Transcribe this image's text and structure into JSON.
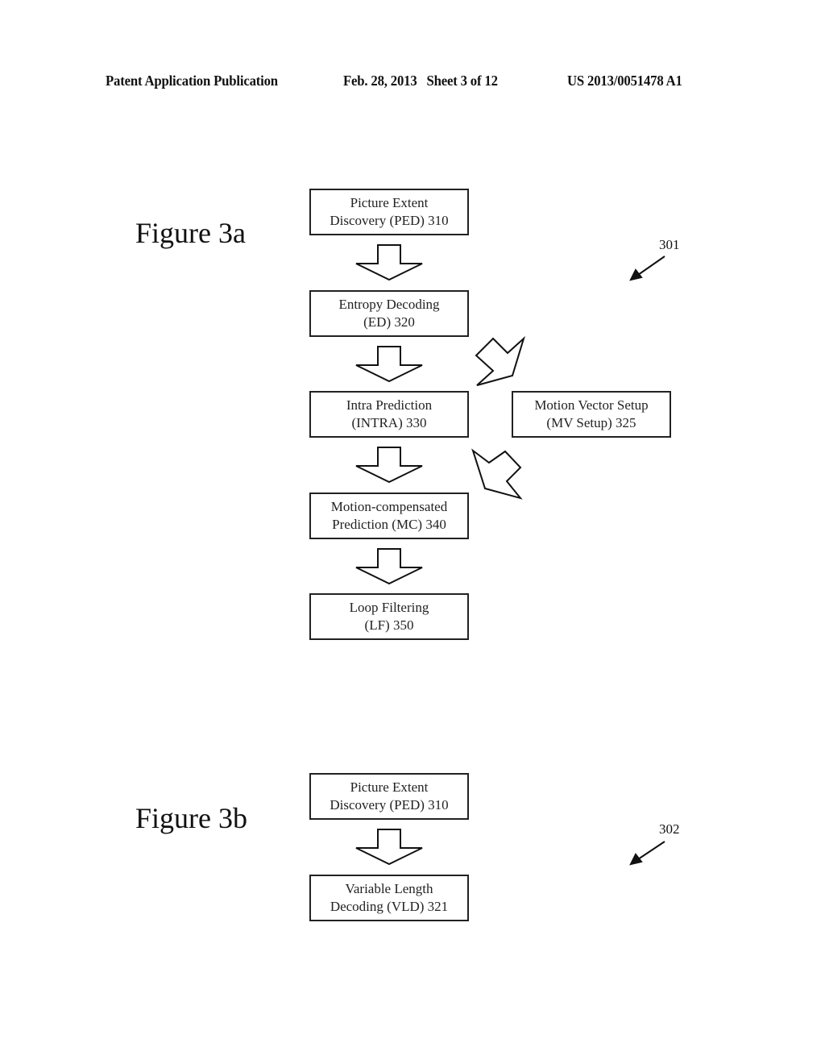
{
  "header": {
    "publication": "Patent Application Publication",
    "date_sheet": "Feb. 28, 2013   Sheet 3 of 12",
    "patent_number": "US 2013/0051478 A1"
  },
  "figure_3a": {
    "title": "Figure 3a",
    "reference": "301",
    "boxes": [
      {
        "line1": "Picture Extent",
        "line2": "Discovery (PED) 310"
      },
      {
        "line1": "Entropy Decoding",
        "line2": "(ED) 320"
      },
      {
        "line1": "Intra Prediction",
        "line2": "(INTRA) 330"
      },
      {
        "line1": "Motion-compensated",
        "line2": "Prediction (MC) 340"
      },
      {
        "line1": "Loop Filtering",
        "line2": "(LF) 350"
      }
    ],
    "side_box": {
      "line1": "Motion Vector Setup",
      "line2": "(MV Setup) 325"
    }
  },
  "figure_3b": {
    "title": "Figure 3b",
    "reference": "302",
    "boxes": [
      {
        "line1": "Picture Extent",
        "line2": "Discovery (PED) 310"
      },
      {
        "line1": "Variable Length",
        "line2": "Decoding (VLD) 321"
      }
    ]
  }
}
